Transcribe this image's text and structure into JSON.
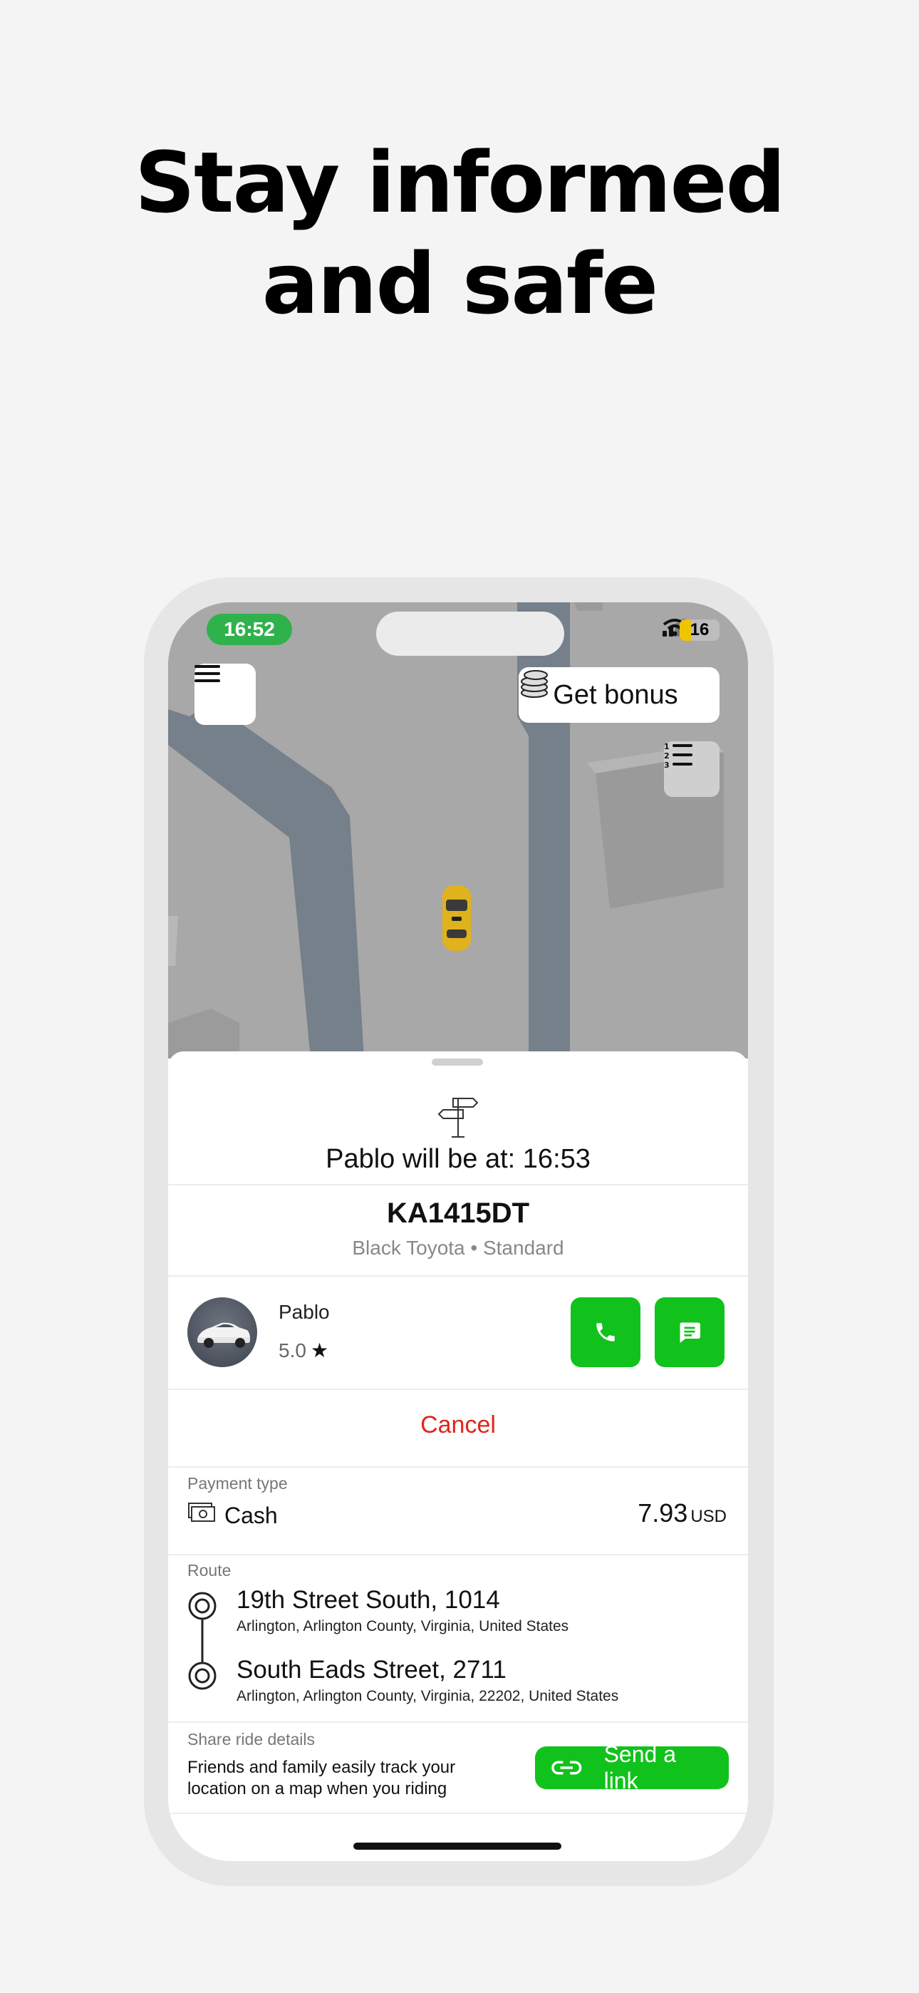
{
  "headline": {
    "line1": "Stay informed",
    "line2": "and safe"
  },
  "status_bar": {
    "time": "16:52",
    "battery": "16"
  },
  "map_controls": {
    "bonus_label": "Get bonus"
  },
  "trip": {
    "eta_text": "Pablo will be at: 16:53",
    "plate": "KA1415DT",
    "car_description": "Black Toyota  •  Standard"
  },
  "driver": {
    "name": "Pablo",
    "rating": "5.0",
    "rating_star": "★"
  },
  "actions": {
    "cancel_label": "Cancel"
  },
  "payment": {
    "label": "Payment type",
    "method": "Cash",
    "amount": "7.93",
    "currency": "USD"
  },
  "route": {
    "label": "Route",
    "stops": [
      {
        "street": "19th Street South, 1014",
        "detail": "Arlington, Arlington County, Virginia, United States"
      },
      {
        "street": "South Eads Street, 2711",
        "detail": "Arlington, Arlington County, Virginia, 22202, United States"
      }
    ]
  },
  "share": {
    "label": "Share ride details",
    "description": "Friends and family easily track your location on a map when you riding",
    "button_label": "Send a link"
  },
  "colors": {
    "accent_green": "#12c21c",
    "cancel_red": "#e0251b",
    "status_green": "#2fb24c"
  }
}
